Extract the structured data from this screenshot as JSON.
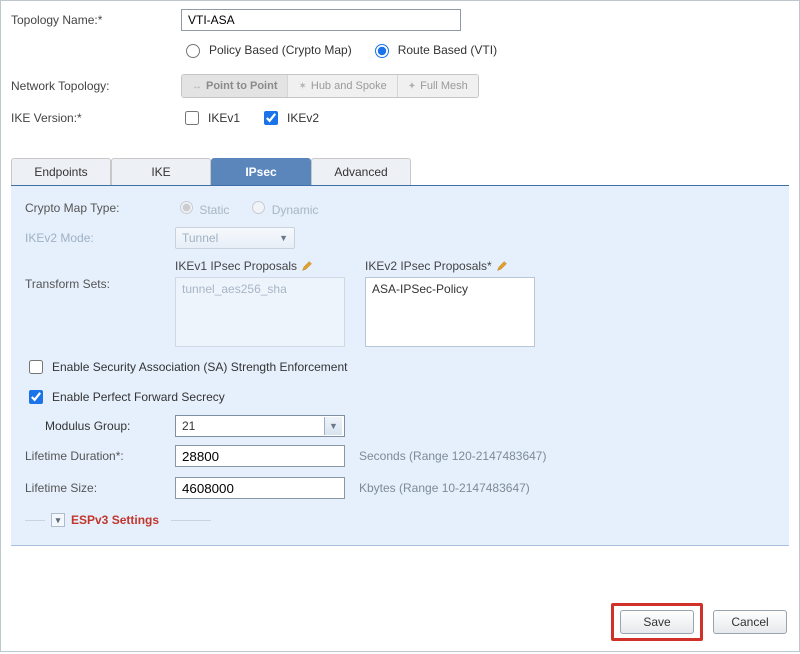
{
  "form": {
    "topology_name_label": "Topology Name:*",
    "topology_name_value": "VTI-ASA",
    "policy_based_label": "Policy Based (Crypto Map)",
    "route_based_label": "Route Based (VTI)",
    "policy_selected": "route",
    "network_topology_label": "Network Topology:",
    "topology_options": {
      "ptp": "Point to Point",
      "hub": "Hub and Spoke",
      "full": "Full Mesh"
    },
    "ike_version_label": "IKE Version:*",
    "ikev1_label": "IKEv1",
    "ikev2_label": "IKEv2",
    "ikev1_checked": false,
    "ikev2_checked": true
  },
  "tabs": {
    "endpoints": "Endpoints",
    "ike": "IKE",
    "ipsec": "IPsec",
    "advanced": "Advanced",
    "active": "ipsec"
  },
  "ipsec": {
    "crypto_map_label": "Crypto Map Type:",
    "crypto_static": "Static",
    "crypto_dynamic": "Dynamic",
    "ikev2_mode_label": "IKEv2 Mode:",
    "ikev2_mode_value": "Tunnel",
    "transform_sets_label": "Transform Sets:",
    "ikev1_proposals_label": "IKEv1 IPsec Proposals",
    "ikev1_proposals_value": "tunnel_aes256_sha",
    "ikev2_proposals_label": "IKEv2 IPsec Proposals*",
    "ikev2_proposals_value": "ASA-IPSec-Policy",
    "sa_enforce_label": "Enable Security Association (SA) Strength Enforcement",
    "sa_enforce_checked": false,
    "pfs_label": "Enable Perfect Forward Secrecy",
    "pfs_checked": true,
    "modulus_label": "Modulus Group:",
    "modulus_value": "21",
    "lifetime_duration_label": "Lifetime Duration*:",
    "lifetime_duration_value": "28800",
    "lifetime_duration_hint": "Seconds (Range 120-2147483647)",
    "lifetime_size_label": "Lifetime Size:",
    "lifetime_size_value": "4608000",
    "lifetime_size_hint": "Kbytes (Range 10-2147483647)",
    "espv3_label": "ESPv3 Settings"
  },
  "footer": {
    "save": "Save",
    "cancel": "Cancel"
  }
}
